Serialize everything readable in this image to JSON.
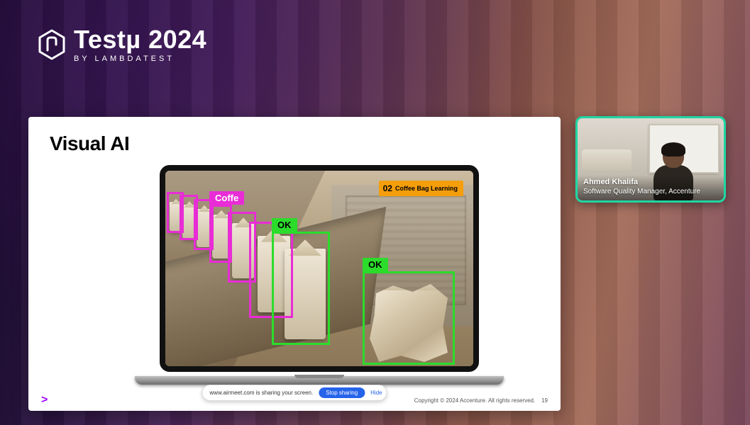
{
  "logo": {
    "main": "Testµ 2024",
    "sub": "BY LAMBDATEST"
  },
  "slide": {
    "title": "Visual AI",
    "info_pill": {
      "num": "02",
      "text": "Coffee Bag Learning"
    },
    "detections": {
      "magenta_label": "Coffe",
      "green1_label": "OK",
      "green2_label": "OK"
    },
    "share_bar": {
      "message": "www.airmeet.com is sharing your screen.",
      "stop": "Stop sharing",
      "hide": "Hide"
    },
    "footer": {
      "copyright": "Copyright © 2024 Accenture. All rights reserved.",
      "page": "19"
    }
  },
  "webcam": {
    "name": "Ahmed Khalifa",
    "title": "Software Quality Manager, Accenture"
  }
}
